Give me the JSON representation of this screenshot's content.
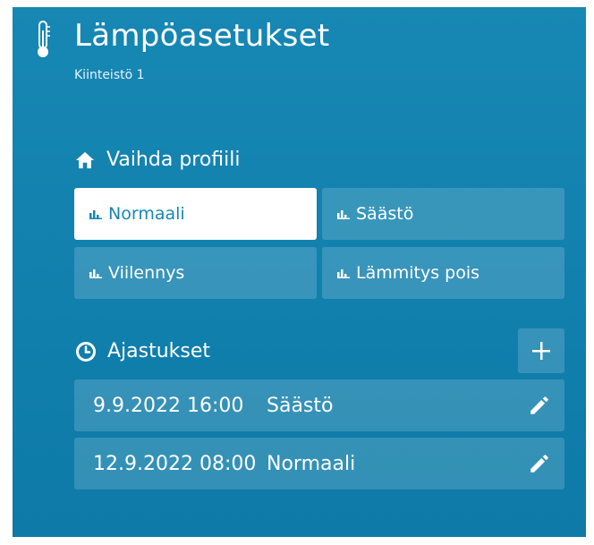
{
  "header": {
    "title": "Lämpöasetukset",
    "subtitle": "Kiinteistö 1",
    "icon": "thermometer-icon"
  },
  "profiles": {
    "heading": "Vaihda profiili",
    "heading_icon": "home-icon",
    "item_icon": "bar-chart-icon",
    "active": "Normaali",
    "items": [
      {
        "label": "Normaali"
      },
      {
        "label": "Säästö"
      },
      {
        "label": "Viilennys"
      },
      {
        "label": "Lämmitys pois"
      }
    ]
  },
  "schedules": {
    "heading": "Ajastukset",
    "heading_icon": "clock-icon",
    "add_icon": "plus-icon",
    "edit_icon": "pencil-icon",
    "items": [
      {
        "datetime": "9.9.2022 16:00",
        "profile": "Säästö"
      },
      {
        "datetime": "12.9.2022 08:00",
        "profile": "Normaali"
      }
    ]
  },
  "colors": {
    "background": "#1787b4",
    "active_button": "#ffffff",
    "active_text": "#1787b4",
    "text": "#ffffff"
  }
}
